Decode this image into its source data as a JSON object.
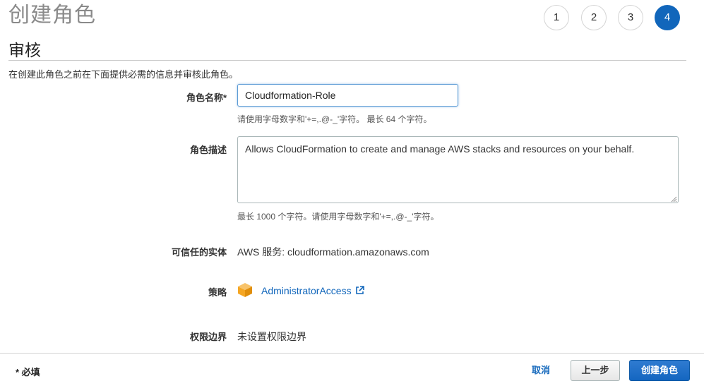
{
  "page": {
    "title": "创建角色"
  },
  "wizard": {
    "steps": [
      {
        "label": "1",
        "active": false
      },
      {
        "label": "2",
        "active": false
      },
      {
        "label": "3",
        "active": false
      },
      {
        "label": "4",
        "active": true
      }
    ]
  },
  "review": {
    "title": "审核",
    "intro": "在创建此角色之前在下面提供必需的信息并审核此角色。"
  },
  "role_name": {
    "label": "角色名称*",
    "value": "Cloudformation-Role",
    "hint": "请使用字母数字和'+=,.@-_'字符。 最长 64 个字符。"
  },
  "role_description": {
    "label": "角色描述",
    "value": "Allows CloudFormation to create and manage AWS stacks and resources on your behalf.",
    "hint": "最长 1000 个字符。请使用字母数字和'+=,.@-_'字符。"
  },
  "trusted_entity": {
    "label": "可信任的实体",
    "value": "AWS 服务: cloudformation.amazonaws.com"
  },
  "policies": {
    "label": "策略",
    "items": [
      {
        "name": "AdministratorAccess",
        "icon": "policy-cube-icon"
      }
    ]
  },
  "permissions_boundary": {
    "label": "权限边界",
    "value": "未设置权限边界"
  },
  "footer": {
    "required_note": "* 必填",
    "cancel_label": "取消",
    "previous_label": "上一步",
    "create_label": "创建角色"
  },
  "colors": {
    "accent": "#1166bb",
    "policy_icon": "#f5a623"
  }
}
